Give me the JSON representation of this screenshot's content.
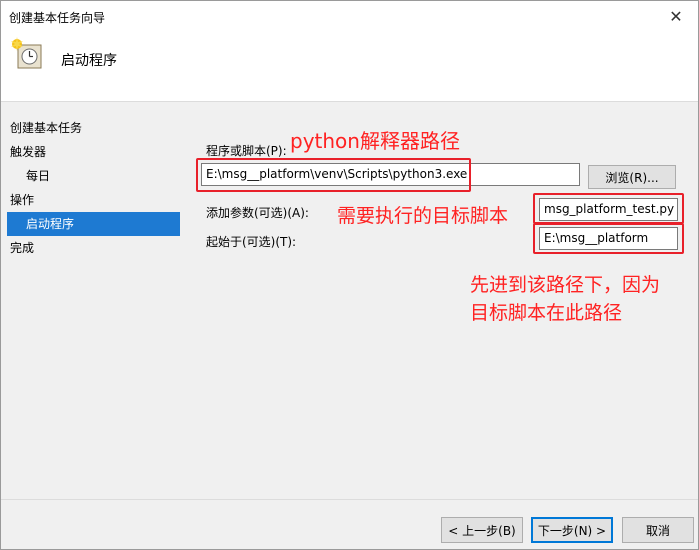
{
  "window": {
    "title": "创建基本任务向导",
    "close_glyph": "✕"
  },
  "header": {
    "title": "启动程序",
    "icon": "clock-task-icon"
  },
  "nav": {
    "items": [
      {
        "label": "创建基本任务",
        "level": 0
      },
      {
        "label": "触发器",
        "level": 0
      },
      {
        "label": "每日",
        "level": 1
      },
      {
        "label": "操作",
        "level": 0
      },
      {
        "label": "启动程序",
        "level": 1,
        "active": true
      },
      {
        "label": "完成",
        "level": 0
      }
    ]
  },
  "form": {
    "program_label": "程序或脚本(P):",
    "program_value": "E:\\msg__platform\\venv\\Scripts\\python3.exe",
    "browse_label": "浏览(R)...",
    "args_label": "添加参数(可选)(A):",
    "args_value": "msg_platform_test.py",
    "start_label": "起始于(可选)(T):",
    "start_value": "E:\\msg__platform"
  },
  "annotations": {
    "python": "python解释器路径",
    "script": "需要执行的目标脚本",
    "note_line1": "先进到该路径下，因为",
    "note_line2": "目标脚本在此路径"
  },
  "footer": {
    "back_label": "< 上一步(B)",
    "next_label": "下一步(N) >",
    "cancel_label": "取消"
  },
  "colors": {
    "accent": "#1e7ad2",
    "annotation": "#ff2222"
  }
}
